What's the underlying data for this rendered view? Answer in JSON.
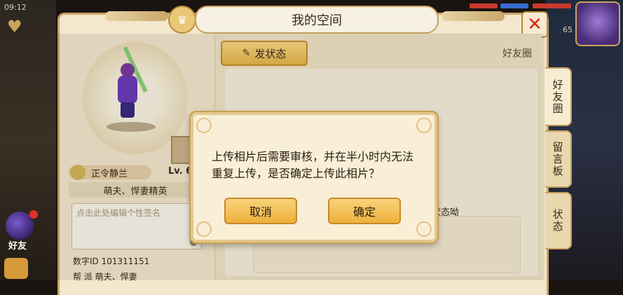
{
  "status_bar": {
    "time": "09:12"
  },
  "hud": {
    "level_number": "65",
    "friends_label": "好友"
  },
  "window": {
    "title": "我的空间"
  },
  "profile": {
    "name": "正令静兰",
    "level": "Lv. 6",
    "title": "萌夫、悍妻精英",
    "signature_placeholder": "点击此处编辑个性签名",
    "digit_id": "数字ID 101311151",
    "faction": "帮   派 萌夫、悍妻"
  },
  "content": {
    "post_button_label": "发状态",
    "moments_label": "好友圈",
    "feed_hint": "状态呦"
  },
  "side_tabs": [
    {
      "label": "好友圈"
    },
    {
      "label": "留言板"
    },
    {
      "label": "状态"
    }
  ],
  "dialog": {
    "message": "上传相片后需要审核，并在半小时内无法重复上传，是否确定上传此相片？",
    "cancel_label": "取消",
    "confirm_label": "确定"
  },
  "colors": {
    "panel_bg": "#f3e7cc",
    "button_gold": "#eeb03c",
    "close_red": "#d22a1e"
  }
}
